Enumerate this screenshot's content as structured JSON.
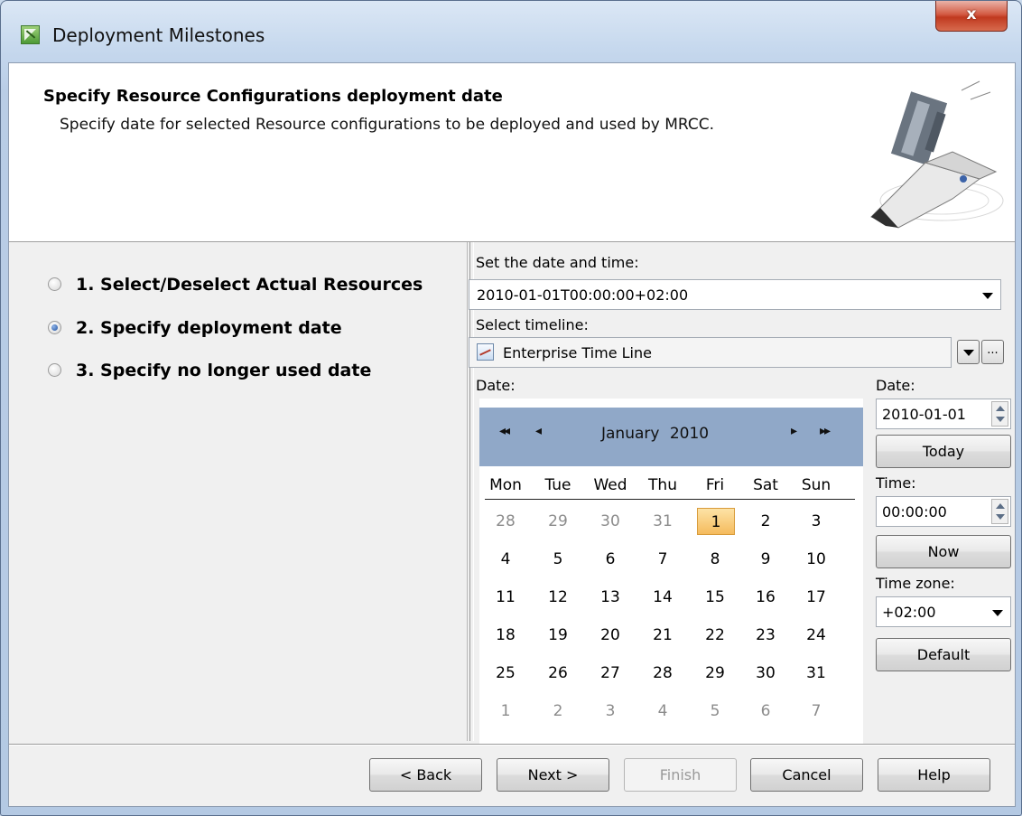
{
  "window": {
    "title": "Deployment Milestones",
    "close_label": "x"
  },
  "header": {
    "title": "Specify Resource Configurations deployment date",
    "description": "Specify date for selected Resource configurations to be deployed and used by MRCC."
  },
  "steps": [
    {
      "label": "1. Select/Deselect Actual Resources",
      "selected": false
    },
    {
      "label": "2. Specify deployment date",
      "selected": true
    },
    {
      "label": "3. Specify no longer used date",
      "selected": false
    }
  ],
  "datetime": {
    "label": "Set the date and time:",
    "value": "2010-01-01T00:00:00+02:00"
  },
  "timeline": {
    "label": "Select timeline:",
    "value": "Enterprise Time Line",
    "more_label": "..."
  },
  "calendar": {
    "label": "Date:",
    "nav_prev_year": "◂◂",
    "nav_prev_month": "◂",
    "nav_next_month": "▸",
    "nav_next_year": "▸▸",
    "month": "January",
    "year": "2010",
    "day_names": [
      "Mon",
      "Tue",
      "Wed",
      "Thu",
      "Fri",
      "Sat",
      "Sun"
    ],
    "weeks": [
      [
        "28",
        "29",
        "30",
        "31",
        "1",
        "2",
        "3"
      ],
      [
        "4",
        "5",
        "6",
        "7",
        "8",
        "9",
        "10"
      ],
      [
        "11",
        "12",
        "13",
        "14",
        "15",
        "16",
        "17"
      ],
      [
        "18",
        "19",
        "20",
        "21",
        "22",
        "23",
        "24"
      ],
      [
        "25",
        "26",
        "27",
        "28",
        "29",
        "30",
        "31"
      ],
      [
        "1",
        "2",
        "3",
        "4",
        "5",
        "6",
        "7"
      ]
    ],
    "selected_day": "1"
  },
  "side": {
    "date_label": "Date:",
    "date_value": "2010-01-01",
    "today_button": "Today",
    "time_label": "Time:",
    "time_value": "00:00:00",
    "now_button": "Now",
    "timezone_label": "Time zone:",
    "timezone_value": "+02:00",
    "default_button": "Default"
  },
  "footer": {
    "back": "< Back",
    "next": "Next >",
    "finish": "Finish",
    "cancel": "Cancel",
    "help": "Help"
  }
}
